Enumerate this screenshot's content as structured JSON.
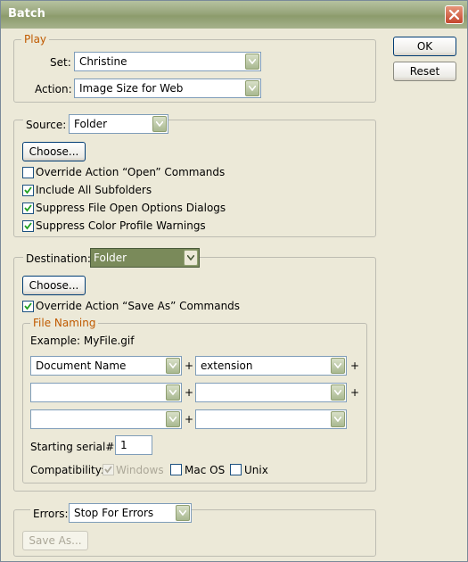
{
  "window": {
    "title": "Batch"
  },
  "buttons": {
    "ok": "OK",
    "reset": "Reset"
  },
  "play": {
    "legend": "Play",
    "set_label": "Set:",
    "set_value": "Christine",
    "action_label": "Action:",
    "action_value": "Image Size for Web"
  },
  "source": {
    "label": "Source:",
    "value": "Folder",
    "choose_label": "Choose...",
    "checkboxes": [
      {
        "label": "Override Action “Open” Commands",
        "checked": false
      },
      {
        "label": "Include All Subfolders",
        "checked": true
      },
      {
        "label": "Suppress File Open Options Dialogs",
        "checked": true
      },
      {
        "label": "Suppress Color Profile Warnings",
        "checked": true
      }
    ]
  },
  "destination": {
    "label": "Destination:",
    "value": "Folder",
    "choose_label": "Choose...",
    "override_label": "Override Action “Save As” Commands",
    "override_checked": true,
    "file_naming": {
      "legend": "File Naming",
      "example": "Example: MyFile.gif",
      "rows": [
        {
          "left": "Document Name",
          "right": "extension"
        },
        {
          "left": "",
          "right": ""
        },
        {
          "left": "",
          "right": ""
        }
      ],
      "plus": "+",
      "serial_label": "Starting serial#:",
      "serial_value": "1",
      "compat_label": "Compatibility:",
      "compat": [
        {
          "label": "Windows",
          "checked": true,
          "disabled": true
        },
        {
          "label": "Mac OS",
          "checked": false,
          "disabled": false
        },
        {
          "label": "Unix",
          "checked": false,
          "disabled": false
        }
      ]
    }
  },
  "errors": {
    "label": "Errors:",
    "value": "Stop For Errors",
    "save_as_label": "Save As..."
  },
  "colors": {
    "title_bar": "#97a57a",
    "destination_highlight": "#7a8a5a",
    "legend_orange": "#c05a00"
  }
}
